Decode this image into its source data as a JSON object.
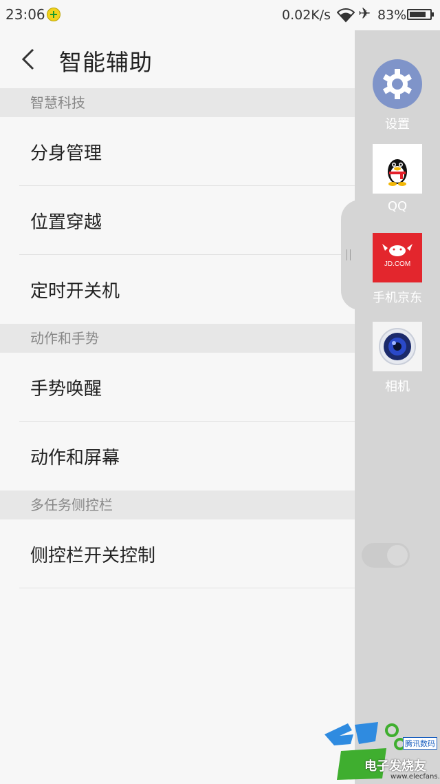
{
  "status_bar": {
    "time": "23:06",
    "speed": "0.02K/s",
    "battery": "83%",
    "battery_level": 0.83
  },
  "header": {
    "title": "智能辅助"
  },
  "sections": [
    {
      "title": "智慧科技",
      "items": [
        "分身管理",
        "位置穿越",
        "定时开关机"
      ]
    },
    {
      "title": "动作和手势",
      "items": [
        "手势唤醒",
        "动作和屏幕"
      ]
    },
    {
      "title": "多任务侧控栏",
      "items": [
        "侧控栏开关控制"
      ]
    }
  ],
  "side_bar": {
    "apps": [
      {
        "label": "设置",
        "icon": "gear-icon"
      },
      {
        "label": "QQ",
        "icon": "qq-penguin-icon"
      },
      {
        "label": "手机京东",
        "icon": "jd-icon",
        "tile_text": "JD.COM"
      },
      {
        "label": "相机",
        "icon": "camera-lens-icon"
      }
    ]
  },
  "watermark": {
    "brand": "电子发烧友",
    "tag": "腾讯数码",
    "url": "www.elecfans.com"
  },
  "colors": {
    "background": "#f7f7f7",
    "section_header": "#e7e7e7",
    "side_bar": "#d5d5d5",
    "settings_tile": "#7f94c9",
    "jd_tile": "#e3262d"
  }
}
